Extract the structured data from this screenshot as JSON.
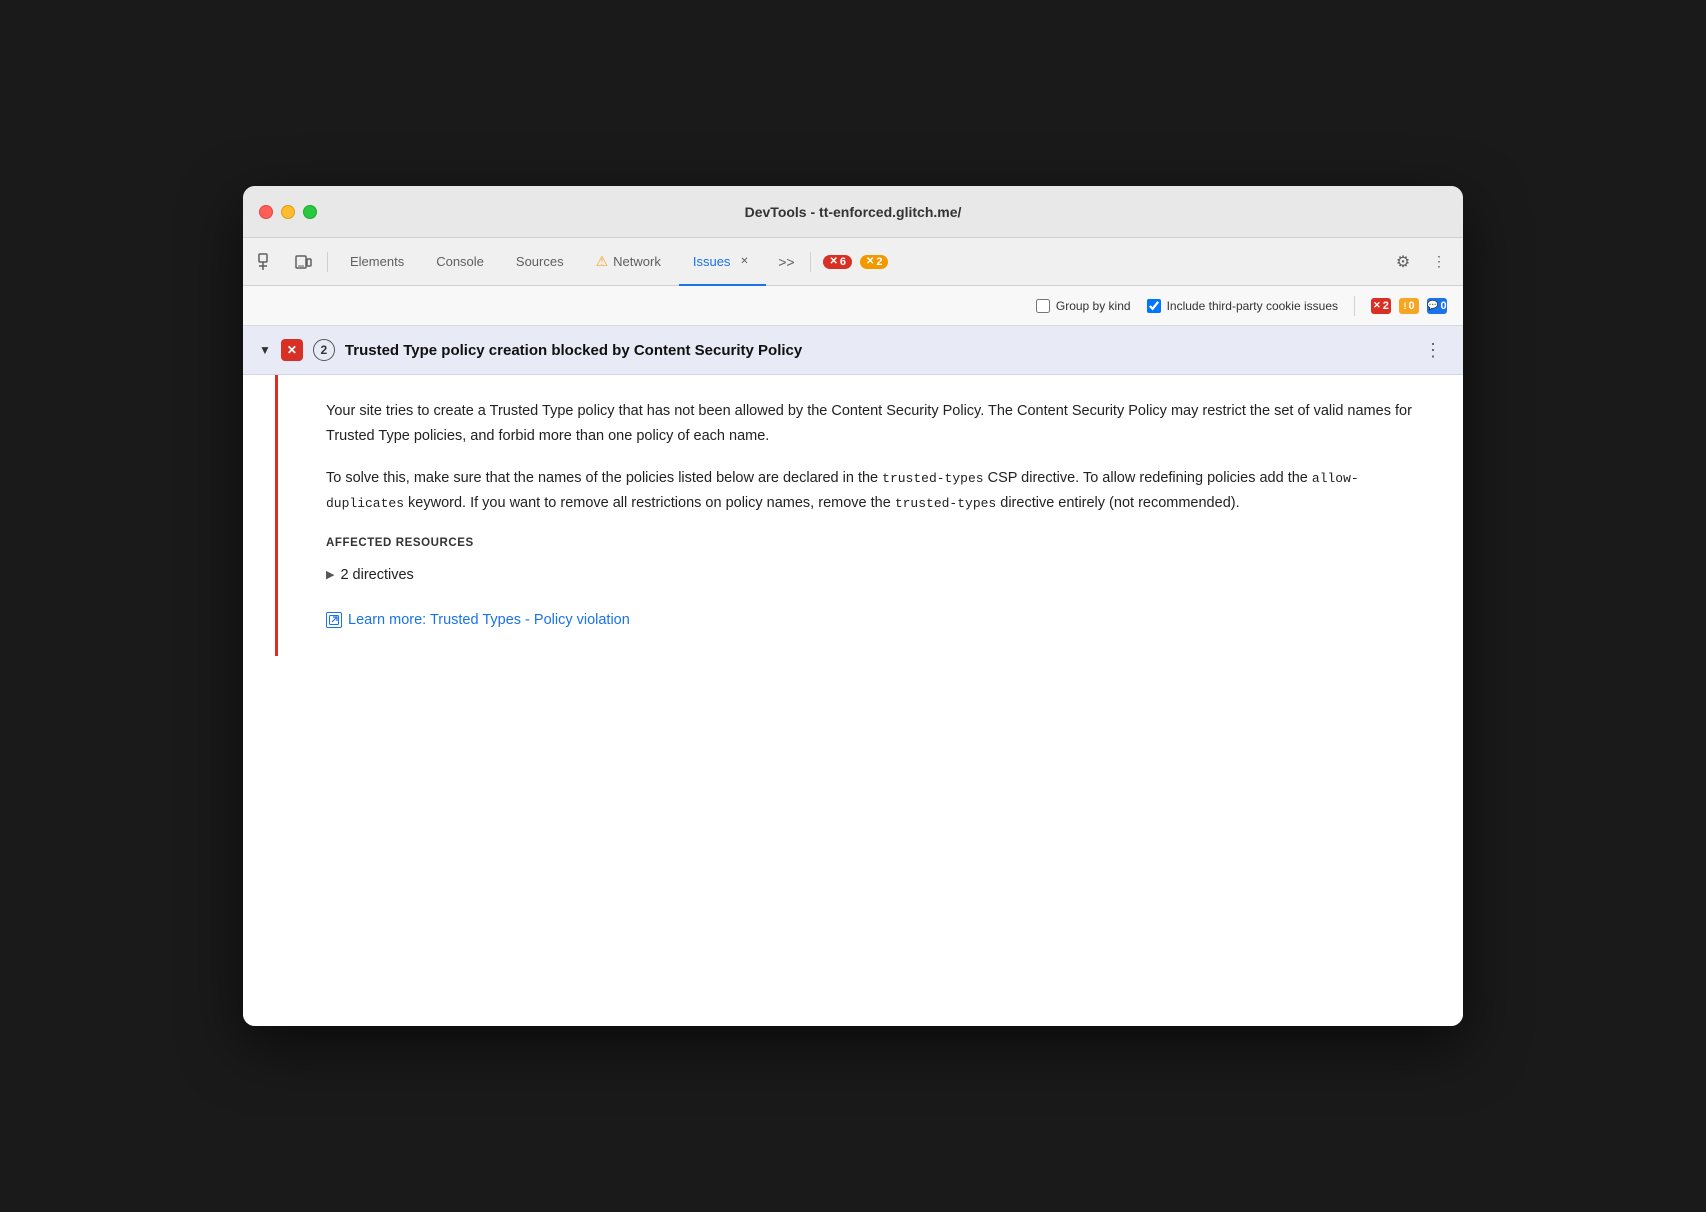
{
  "window": {
    "title": "DevTools - tt-enforced.glitch.me/"
  },
  "toolbar": {
    "elements_label": "Elements",
    "console_label": "Console",
    "sources_label": "Sources",
    "network_label": "Network",
    "issues_label": "Issues",
    "error_count": "6",
    "warning_count": "2",
    "more_tabs_label": ">>",
    "settings_icon": "⚙",
    "more_icon": "⋮"
  },
  "issues_toolbar": {
    "group_by_kind_label": "Group by kind",
    "include_third_party_label": "Include third-party cookie issues",
    "error_count": "2",
    "warning_count": "0",
    "info_count": "0"
  },
  "issue": {
    "title": "Trusted Type policy creation blocked by Content Security Policy",
    "count": "2",
    "description_1": "Your site tries to create a Trusted Type policy that has not been allowed by the Content Security Policy. The Content Security Policy may restrict the set of valid names for Trusted Type policies, and forbid more than one policy of each name.",
    "description_2_part1": "To solve this, make sure that the names of the policies listed below are declared in the ",
    "description_2_code1": "trusted-types",
    "description_2_part2": " CSP directive. To allow redefining policies add the ",
    "description_2_code2": "allow-\nduplicates",
    "description_2_part3": " keyword. If you want to remove all restrictions on policy names, remove the ",
    "description_2_code3": "trusted-types",
    "description_2_part4": " directive entirely (not recommended).",
    "affected_resources_label": "AFFECTED RESOURCES",
    "directives_label": "2 directives",
    "learn_more_label": "Learn more: Trusted Types - Policy violation"
  }
}
